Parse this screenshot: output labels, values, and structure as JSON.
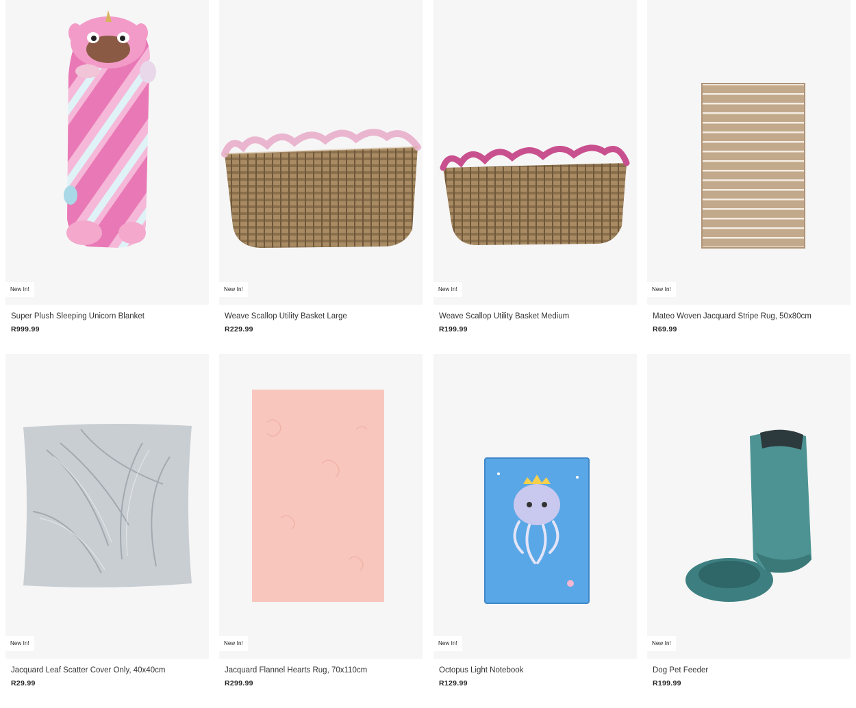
{
  "products": [
    {
      "name": "Super Plush Sleeping Unicorn Blanket",
      "price": "R999.99",
      "badge": "New In!",
      "image_icon": "unicorn-blanket-image"
    },
    {
      "name": "Weave Scallop Utility Basket Large",
      "price": "R229.99",
      "badge": "New In!",
      "image_icon": "woven-basket-image"
    },
    {
      "name": "Weave Scallop Utility Basket Medium",
      "price": "R199.99",
      "badge": "New In!",
      "image_icon": "woven-basket-image"
    },
    {
      "name": "Mateo Woven Jacquard Stripe Rug, 50x80cm",
      "price": "R69.99",
      "badge": "New In!",
      "image_icon": "striped-rug-image"
    },
    {
      "name": "Jacquard Leaf Scatter Cover Only, 40x40cm",
      "price": "R29.99",
      "badge": "New In!",
      "image_icon": "cushion-cover-image"
    },
    {
      "name": "Jacquard Flannel Hearts Rug, 70x110cm",
      "price": "R299.99",
      "badge": "New In!",
      "image_icon": "pink-rug-image"
    },
    {
      "name": "Octopus Light Notebook",
      "price": "R129.99",
      "badge": "New In!",
      "image_icon": "notebook-image"
    },
    {
      "name": "Dog Pet Feeder",
      "price": "R199.99",
      "badge": "New In!",
      "image_icon": "pet-feeder-image"
    }
  ],
  "colors": {
    "card_background": "#f6f6f6",
    "price_text": "#1f1f1f",
    "name_text": "#333333"
  }
}
